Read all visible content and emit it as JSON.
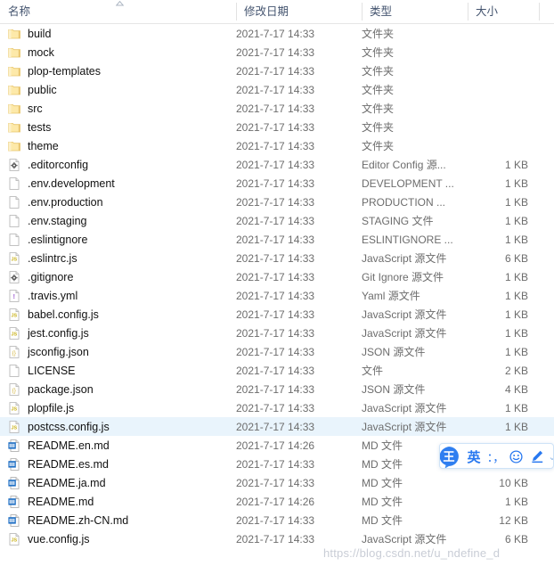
{
  "columns": {
    "name": "名称",
    "date_modified": "修改日期",
    "type": "类型",
    "size": "大小",
    "sort_indicator": "ascending-sort-caret"
  },
  "files": [
    {
      "name": "build",
      "date": "2021-7-17 14:33",
      "type": "文件夹",
      "size": "",
      "icon": "folder-icon",
      "selected": false
    },
    {
      "name": "mock",
      "date": "2021-7-17 14:33",
      "type": "文件夹",
      "size": "",
      "icon": "folder-icon",
      "selected": false
    },
    {
      "name": "plop-templates",
      "date": "2021-7-17 14:33",
      "type": "文件夹",
      "size": "",
      "icon": "folder-icon",
      "selected": false
    },
    {
      "name": "public",
      "date": "2021-7-17 14:33",
      "type": "文件夹",
      "size": "",
      "icon": "folder-icon",
      "selected": false
    },
    {
      "name": "src",
      "date": "2021-7-17 14:33",
      "type": "文件夹",
      "size": "",
      "icon": "folder-icon",
      "selected": false
    },
    {
      "name": "tests",
      "date": "2021-7-17 14:33",
      "type": "文件夹",
      "size": "",
      "icon": "folder-icon",
      "selected": false
    },
    {
      "name": "theme",
      "date": "2021-7-17 14:33",
      "type": "文件夹",
      "size": "",
      "icon": "folder-icon",
      "selected": false
    },
    {
      "name": ".editorconfig",
      "date": "2021-7-17 14:33",
      "type": "Editor Config 源...",
      "size": "1 KB",
      "icon": "gear-file-icon",
      "selected": false
    },
    {
      "name": ".env.development",
      "date": "2021-7-17 14:33",
      "type": "DEVELOPMENT ...",
      "size": "1 KB",
      "icon": "blank-file-icon",
      "selected": false
    },
    {
      "name": ".env.production",
      "date": "2021-7-17 14:33",
      "type": "PRODUCTION ...",
      "size": "1 KB",
      "icon": "blank-file-icon",
      "selected": false
    },
    {
      "name": ".env.staging",
      "date": "2021-7-17 14:33",
      "type": "STAGING 文件",
      "size": "1 KB",
      "icon": "blank-file-icon",
      "selected": false
    },
    {
      "name": ".eslintignore",
      "date": "2021-7-17 14:33",
      "type": "ESLINTIGNORE ...",
      "size": "1 KB",
      "icon": "blank-file-icon",
      "selected": false
    },
    {
      "name": ".eslintrc.js",
      "date": "2021-7-17 14:33",
      "type": "JavaScript 源文件",
      "size": "6 KB",
      "icon": "js-file-icon",
      "selected": false
    },
    {
      "name": ".gitignore",
      "date": "2021-7-17 14:33",
      "type": "Git Ignore 源文件",
      "size": "1 KB",
      "icon": "gear-file-icon",
      "selected": false
    },
    {
      "name": ".travis.yml",
      "date": "2021-7-17 14:33",
      "type": "Yaml 源文件",
      "size": "1 KB",
      "icon": "yaml-file-icon",
      "selected": false
    },
    {
      "name": "babel.config.js",
      "date": "2021-7-17 14:33",
      "type": "JavaScript 源文件",
      "size": "1 KB",
      "icon": "js-file-icon",
      "selected": false
    },
    {
      "name": "jest.config.js",
      "date": "2021-7-17 14:33",
      "type": "JavaScript 源文件",
      "size": "1 KB",
      "icon": "js-file-icon",
      "selected": false
    },
    {
      "name": "jsconfig.json",
      "date": "2021-7-17 14:33",
      "type": "JSON 源文件",
      "size": "1 KB",
      "icon": "json-file-icon",
      "selected": false
    },
    {
      "name": "LICENSE",
      "date": "2021-7-17 14:33",
      "type": "文件",
      "size": "2 KB",
      "icon": "blank-file-icon",
      "selected": false
    },
    {
      "name": "package.json",
      "date": "2021-7-17 14:33",
      "type": "JSON 源文件",
      "size": "4 KB",
      "icon": "json-file-icon",
      "selected": false
    },
    {
      "name": "plopfile.js",
      "date": "2021-7-17 14:33",
      "type": "JavaScript 源文件",
      "size": "1 KB",
      "icon": "js-file-icon",
      "selected": false
    },
    {
      "name": "postcss.config.js",
      "date": "2021-7-17 14:33",
      "type": "JavaScript 源文件",
      "size": "1 KB",
      "icon": "js-file-icon",
      "selected": true
    },
    {
      "name": "README.en.md",
      "date": "2021-7-17 14:26",
      "type": "MD 文件",
      "size": "",
      "icon": "md-file-icon",
      "selected": false
    },
    {
      "name": "README.es.md",
      "date": "2021-7-17 14:33",
      "type": "MD 文件",
      "size": "",
      "icon": "md-file-icon",
      "selected": false
    },
    {
      "name": "README.ja.md",
      "date": "2021-7-17 14:33",
      "type": "MD 文件",
      "size": "10 KB",
      "icon": "md-file-icon",
      "selected": false
    },
    {
      "name": "README.md",
      "date": "2021-7-17 14:26",
      "type": "MD 文件",
      "size": "1 KB",
      "icon": "md-file-icon",
      "selected": false
    },
    {
      "name": "README.zh-CN.md",
      "date": "2021-7-17 14:33",
      "type": "MD 文件",
      "size": "12 KB",
      "icon": "md-file-icon",
      "selected": false
    },
    {
      "name": "vue.config.js",
      "date": "2021-7-17 14:33",
      "type": "JavaScript 源文件",
      "size": "6 KB",
      "icon": "js-file-icon",
      "selected": false
    }
  ],
  "ime_toolbar": {
    "logo": "王",
    "mode": "英",
    "punctuation": "：，",
    "emoji": "emoji-icon",
    "pen": "handwriting-pen-icon",
    "more": "⌄"
  },
  "watermark": "https://blog.csdn.net/u_ndefine_d",
  "colors": {
    "selection": "#e9f4fc",
    "header_text": "#44546f",
    "meta_text": "#6d6d6d",
    "folder": "#ffd966",
    "ime_blue": "#2878f0",
    "watermark": "#c9cdd6"
  }
}
